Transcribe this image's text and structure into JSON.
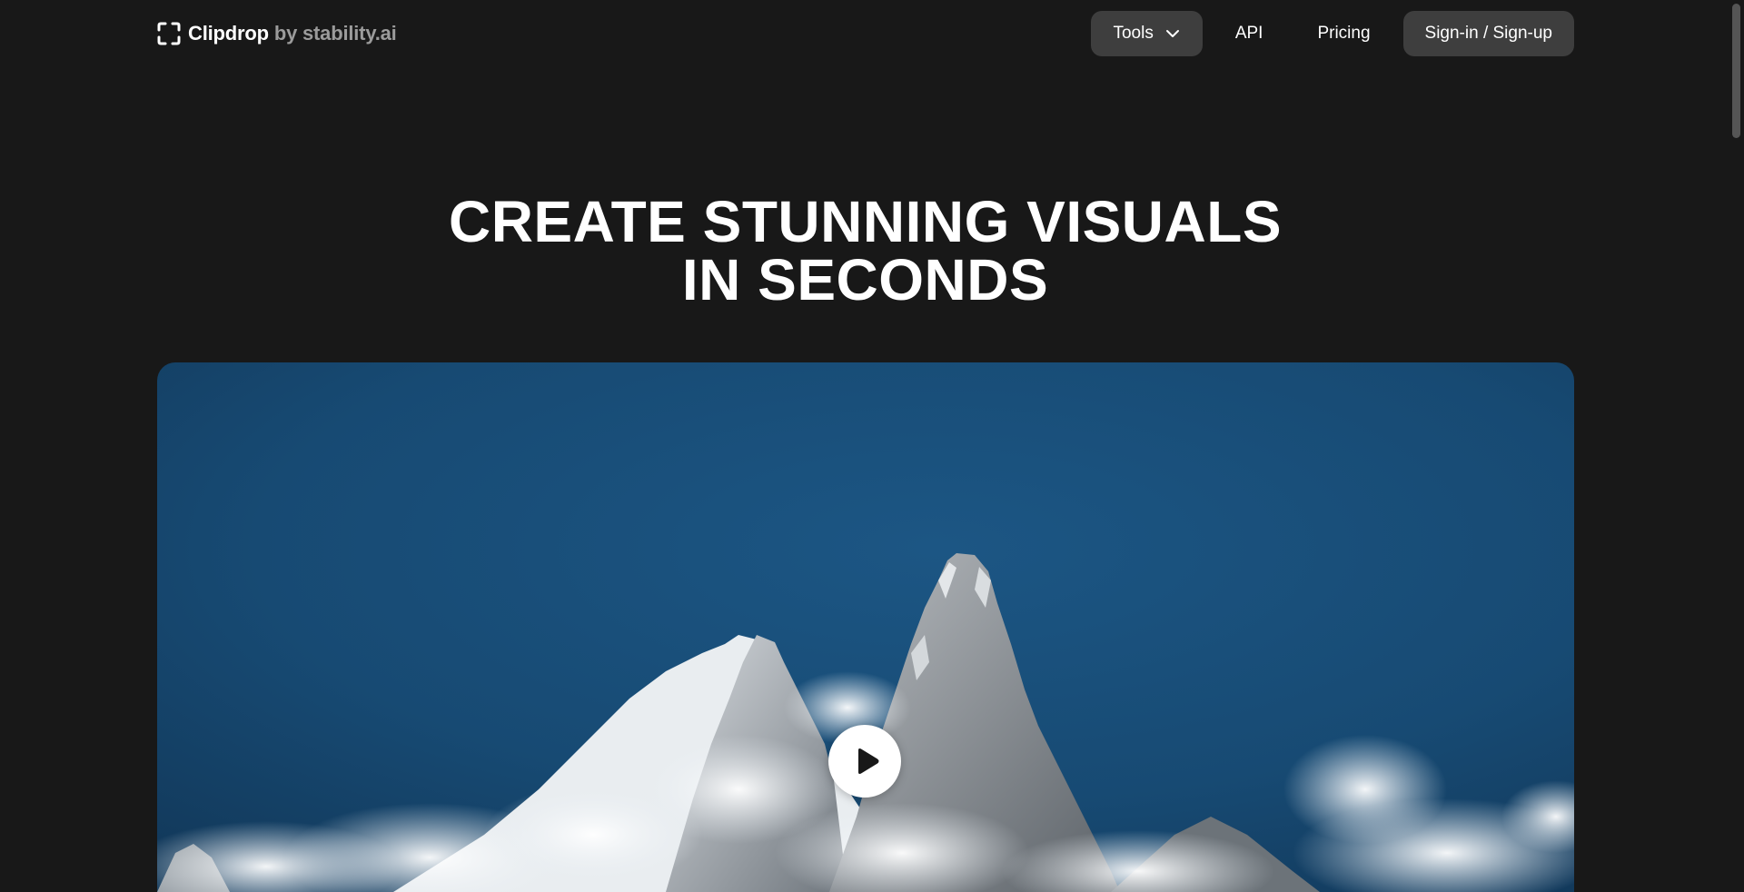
{
  "header": {
    "logo": {
      "brand": "Clipdrop",
      "byline": "by stability.ai",
      "icon": "clipdrop-bracket-icon"
    },
    "nav": {
      "tools_label": "Tools",
      "api_label": "API",
      "pricing_label": "Pricing",
      "signin_label": "Sign-in / Sign-up"
    }
  },
  "hero": {
    "title_line1": "CREATE STUNNING VISUALS",
    "title_line2": "IN SECONDS"
  },
  "media": {
    "play_icon": "play-icon"
  },
  "colors": {
    "background": "#181818",
    "button_fill": "#3e3e3e",
    "sky": "#1a4f7a",
    "byline_gray": "#9b9b9b"
  }
}
